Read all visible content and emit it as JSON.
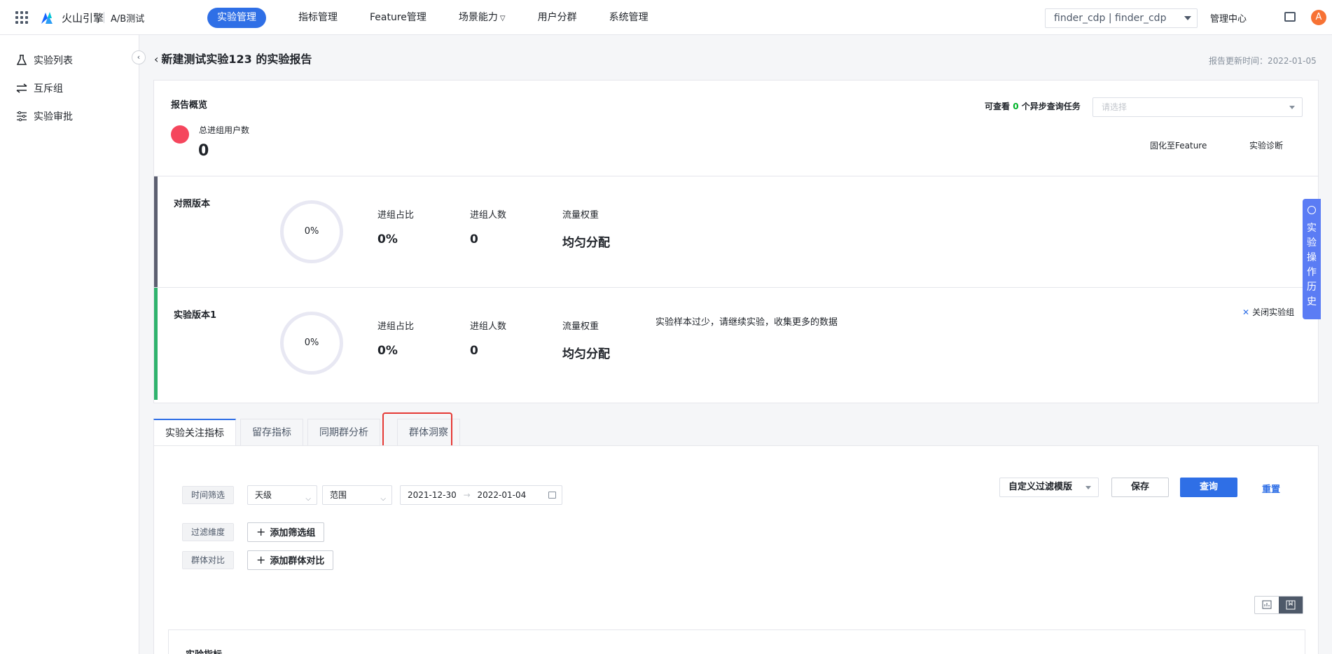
{
  "topbar": {
    "brand": "火山引擎",
    "product": "A/B测试",
    "nav": [
      "实验管理",
      "指标管理",
      "Feature管理",
      "场景能力",
      "用户分群",
      "系统管理"
    ],
    "workspace": "finder_cdp | finder_cdp",
    "admin": "管理中心",
    "avatar": "A"
  },
  "sidebar": {
    "items": [
      "实验列表",
      "互斥组",
      "实验审批"
    ]
  },
  "report": {
    "title": "新建测试实验123 的实验报告",
    "updated": "报告更新时间：2022-01-05"
  },
  "overview": {
    "title": "报告概览",
    "users_label": "总进组用户数",
    "users_value": "0",
    "async_prefix": "可查看",
    "async_count": "0",
    "async_suffix": "个异步查询任务",
    "async_placeholder": "请选择",
    "action_feature": "固化至Feature",
    "action_diagnose": "实验诊断"
  },
  "groups": [
    {
      "name": "对照版本",
      "ring": "0%",
      "ratio_label": "进组占比",
      "ratio_value": "0%",
      "count_label": "进组人数",
      "count_value": "0",
      "weight_label": "流量权重",
      "weight_value": "均匀分配",
      "color": "#5c5f70"
    },
    {
      "name": "实验版本1",
      "ring": "0%",
      "ratio_label": "进组占比",
      "ratio_value": "0%",
      "count_label": "进组人数",
      "count_value": "0",
      "weight_label": "流量权重",
      "weight_value": "均匀分配",
      "message": "实验样本过少，请继续实验，收集更多的数据",
      "close_label": "关闭实验组",
      "color": "#2fb36d"
    }
  ],
  "float_panel": "实验操作历史",
  "tabs": [
    "实验关注指标",
    "留存指标",
    "同期群分析",
    "群体洞察"
  ],
  "filters": {
    "time_label": "时间筛选",
    "granularity": "天级",
    "range": "范围",
    "date_start": "2021-12-30",
    "date_arrow": "→",
    "date_end": "2022-01-04",
    "dimension_label": "过滤维度",
    "add_filter": "添加筛选组",
    "group_label": "群体对比",
    "add_group": "添加群体对比",
    "template": "自定义过滤模版",
    "save": "保存",
    "query": "查询",
    "reset": "重置"
  },
  "metrics": {
    "title": "实验指标"
  },
  "colors": {
    "accent": "#2f6fe6",
    "highlight": "#e53935"
  }
}
